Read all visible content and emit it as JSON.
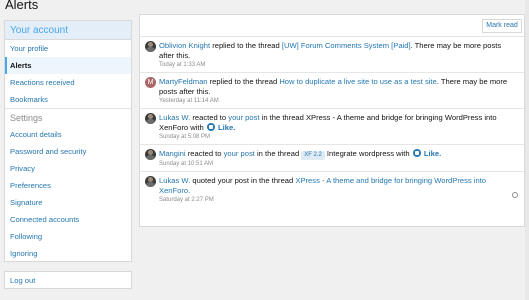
{
  "page": {
    "title": "Alerts"
  },
  "sidebar": {
    "heading": "Your account",
    "items": [
      {
        "label": "Your profile"
      },
      {
        "label": "Alerts"
      },
      {
        "label": "Reactions received"
      },
      {
        "label": "Bookmarks"
      }
    ],
    "settings_heading": "Settings",
    "settings_items": [
      {
        "label": "Account details"
      },
      {
        "label": "Password and security"
      },
      {
        "label": "Privacy"
      },
      {
        "label": "Preferences"
      },
      {
        "label": "Signature"
      },
      {
        "label": "Connected accounts"
      },
      {
        "label": "Following"
      },
      {
        "label": "Ignoring"
      }
    ],
    "logout": "Log out"
  },
  "main": {
    "mark_read": "Mark read",
    "alerts": [
      {
        "user": "Oblivion Knight",
        "pre": "replied to the thread",
        "link": "[UW] Forum Comments System [Paid]",
        "post": ". There may be more posts after this.",
        "time": "Today at 1:33 AM"
      },
      {
        "avatar_letter": "M",
        "user": "MartyFeldman",
        "pre": "replied to the thread",
        "link": "How to duplicate a live site to use as a test site",
        "post": ". There may be more posts after this.",
        "time": "Yesterday at 11:14 AM"
      },
      {
        "user": "Lukas W.",
        "pre": "reacted to",
        "link": "your post",
        "mid": "in the thread XPress - A theme and bridge for bringing WordPress into XenForo with",
        "like": "Like.",
        "time": "Sunday at 5:08 PM"
      },
      {
        "user": "Mangini",
        "pre": "reacted to",
        "link": "your post",
        "mid": "in the thread",
        "prefix": "XF 2.2",
        "mid2": "Integrate wordpress with",
        "like": "Like.",
        "time": "Sunday at 10:51 AM"
      },
      {
        "user": "Lukas W.",
        "pre": "quoted your post in the thread",
        "link": "XPress - A theme and bridge for bringing WordPress into XenForo.",
        "time": "Saturday at 2:27 PM"
      }
    ]
  }
}
